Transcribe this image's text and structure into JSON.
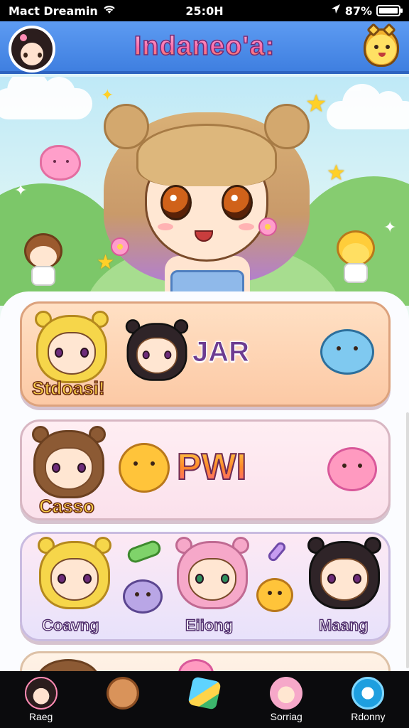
{
  "status_bar": {
    "carrier": "Mact Dreamin",
    "time": "25:0H",
    "battery_text": "87%",
    "battery_level": 0.87,
    "icons": [
      "wifi-icon",
      "location-arrow-icon",
      "battery-icon"
    ]
  },
  "header": {
    "title": "Indaneo'a:",
    "left_icon": "profile-avatar",
    "right_icon": "mascot-face-icon"
  },
  "hero": {
    "decorations": [
      "star-icon",
      "sparkle-icon",
      "cloud",
      "pink-blob-creature"
    ]
  },
  "cards": [
    {
      "title": "JAR",
      "character_labels": [
        "Stdoasi!"
      ]
    },
    {
      "title": "PWI",
      "character_labels": [
        "Casso"
      ]
    },
    {
      "title": "",
      "character_labels": [
        "Coavng",
        "Eiiong",
        "Maang"
      ]
    },
    {
      "title": "",
      "character_labels": []
    }
  ],
  "tab_bar": {
    "tabs": [
      {
        "label": "Raeg",
        "icon": "home-character-icon"
      },
      {
        "label": "",
        "icon": "bag-icon"
      },
      {
        "label": "",
        "icon": "gem-icon"
      },
      {
        "label": "Sorriag",
        "icon": "shop-character-icon"
      },
      {
        "label": "Rdonny",
        "icon": "social-globe-icon"
      }
    ]
  },
  "colors": {
    "header_blue": "#3f7fe0",
    "card_peach": "#fcc9a5",
    "card_pink": "#fbe1ec",
    "card_lavender": "#e8e2fb",
    "tab_bar": "#0b0b0d"
  }
}
